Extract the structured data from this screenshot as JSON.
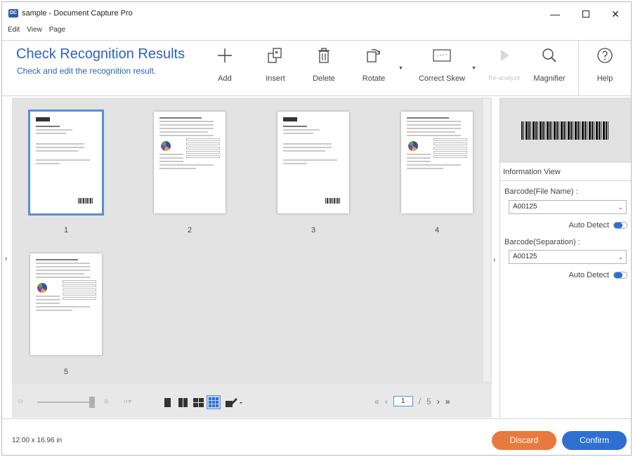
{
  "window": {
    "app_icon_text": "DC",
    "title": "sample - Document Capture Pro",
    "min_glyph": "—",
    "close_glyph": "✕"
  },
  "menu": [
    "Edit",
    "View",
    "Page"
  ],
  "ribbon": {
    "title": "Check Recognition Results",
    "subtitle": "Check and edit the recognition result.",
    "tools": {
      "add": "Add",
      "insert": "Insert",
      "delete": "Delete",
      "rotate": "Rotate",
      "correct_skew": "Correct Skew",
      "reanalyze": "Re-analyze",
      "magnifier": "Magnifier",
      "help": "Help"
    }
  },
  "pages": [
    {
      "number": "1",
      "selected": true
    },
    {
      "number": "2",
      "selected": false
    },
    {
      "number": "3",
      "selected": false
    },
    {
      "number": "4",
      "selected": false
    },
    {
      "number": "5",
      "selected": false
    }
  ],
  "pager": {
    "current": "1",
    "separator": "/",
    "total": "5"
  },
  "info_view": {
    "title": "Information View",
    "barcode_file_label": "Barcode(File Name) :",
    "barcode_file_value": "A00125",
    "barcode_sep_label": "Barcode(Separation) :",
    "barcode_sep_value": "A00125",
    "auto_detect": "Auto Detect",
    "auto_detect_on": true
  },
  "status": {
    "page_size": "12.00 x 16.96 in"
  },
  "buttons": {
    "discard": "Discard",
    "confirm": "Confirm"
  },
  "colors": {
    "accent": "#2c63b7",
    "discard": "#e87a3e",
    "confirm": "#2f6fd2",
    "selection": "#5b8fd6"
  }
}
